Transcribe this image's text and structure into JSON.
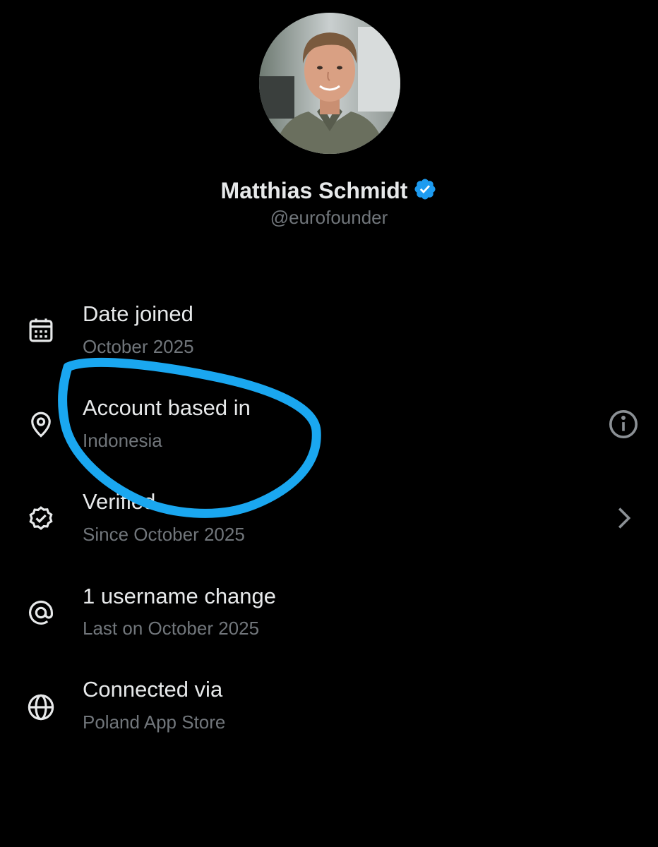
{
  "profile": {
    "name": "Matthias Schmidt",
    "handle": "@eurofounder",
    "verified_color": "#1d9bf0"
  },
  "rows": [
    {
      "icon": "calendar-icon",
      "title": "Date joined",
      "subtitle": "October 2025"
    },
    {
      "icon": "location-pin-icon",
      "title": "Account based in",
      "subtitle": "Indonesia",
      "right_icon": "info-icon"
    },
    {
      "icon": "verified-badge-icon",
      "title": "Verified",
      "subtitle": "Since October 2025",
      "right_icon": "chevron-right-icon"
    },
    {
      "icon": "at-sign-icon",
      "title": "1 username change",
      "subtitle": "Last on October 2025"
    },
    {
      "icon": "globe-icon",
      "title": "Connected via",
      "subtitle": "Poland App Store"
    }
  ],
  "colors": {
    "background": "#000000",
    "primary_text": "#e7e9ea",
    "secondary_text": "#71767b",
    "annotation": "#1aa7f0"
  }
}
